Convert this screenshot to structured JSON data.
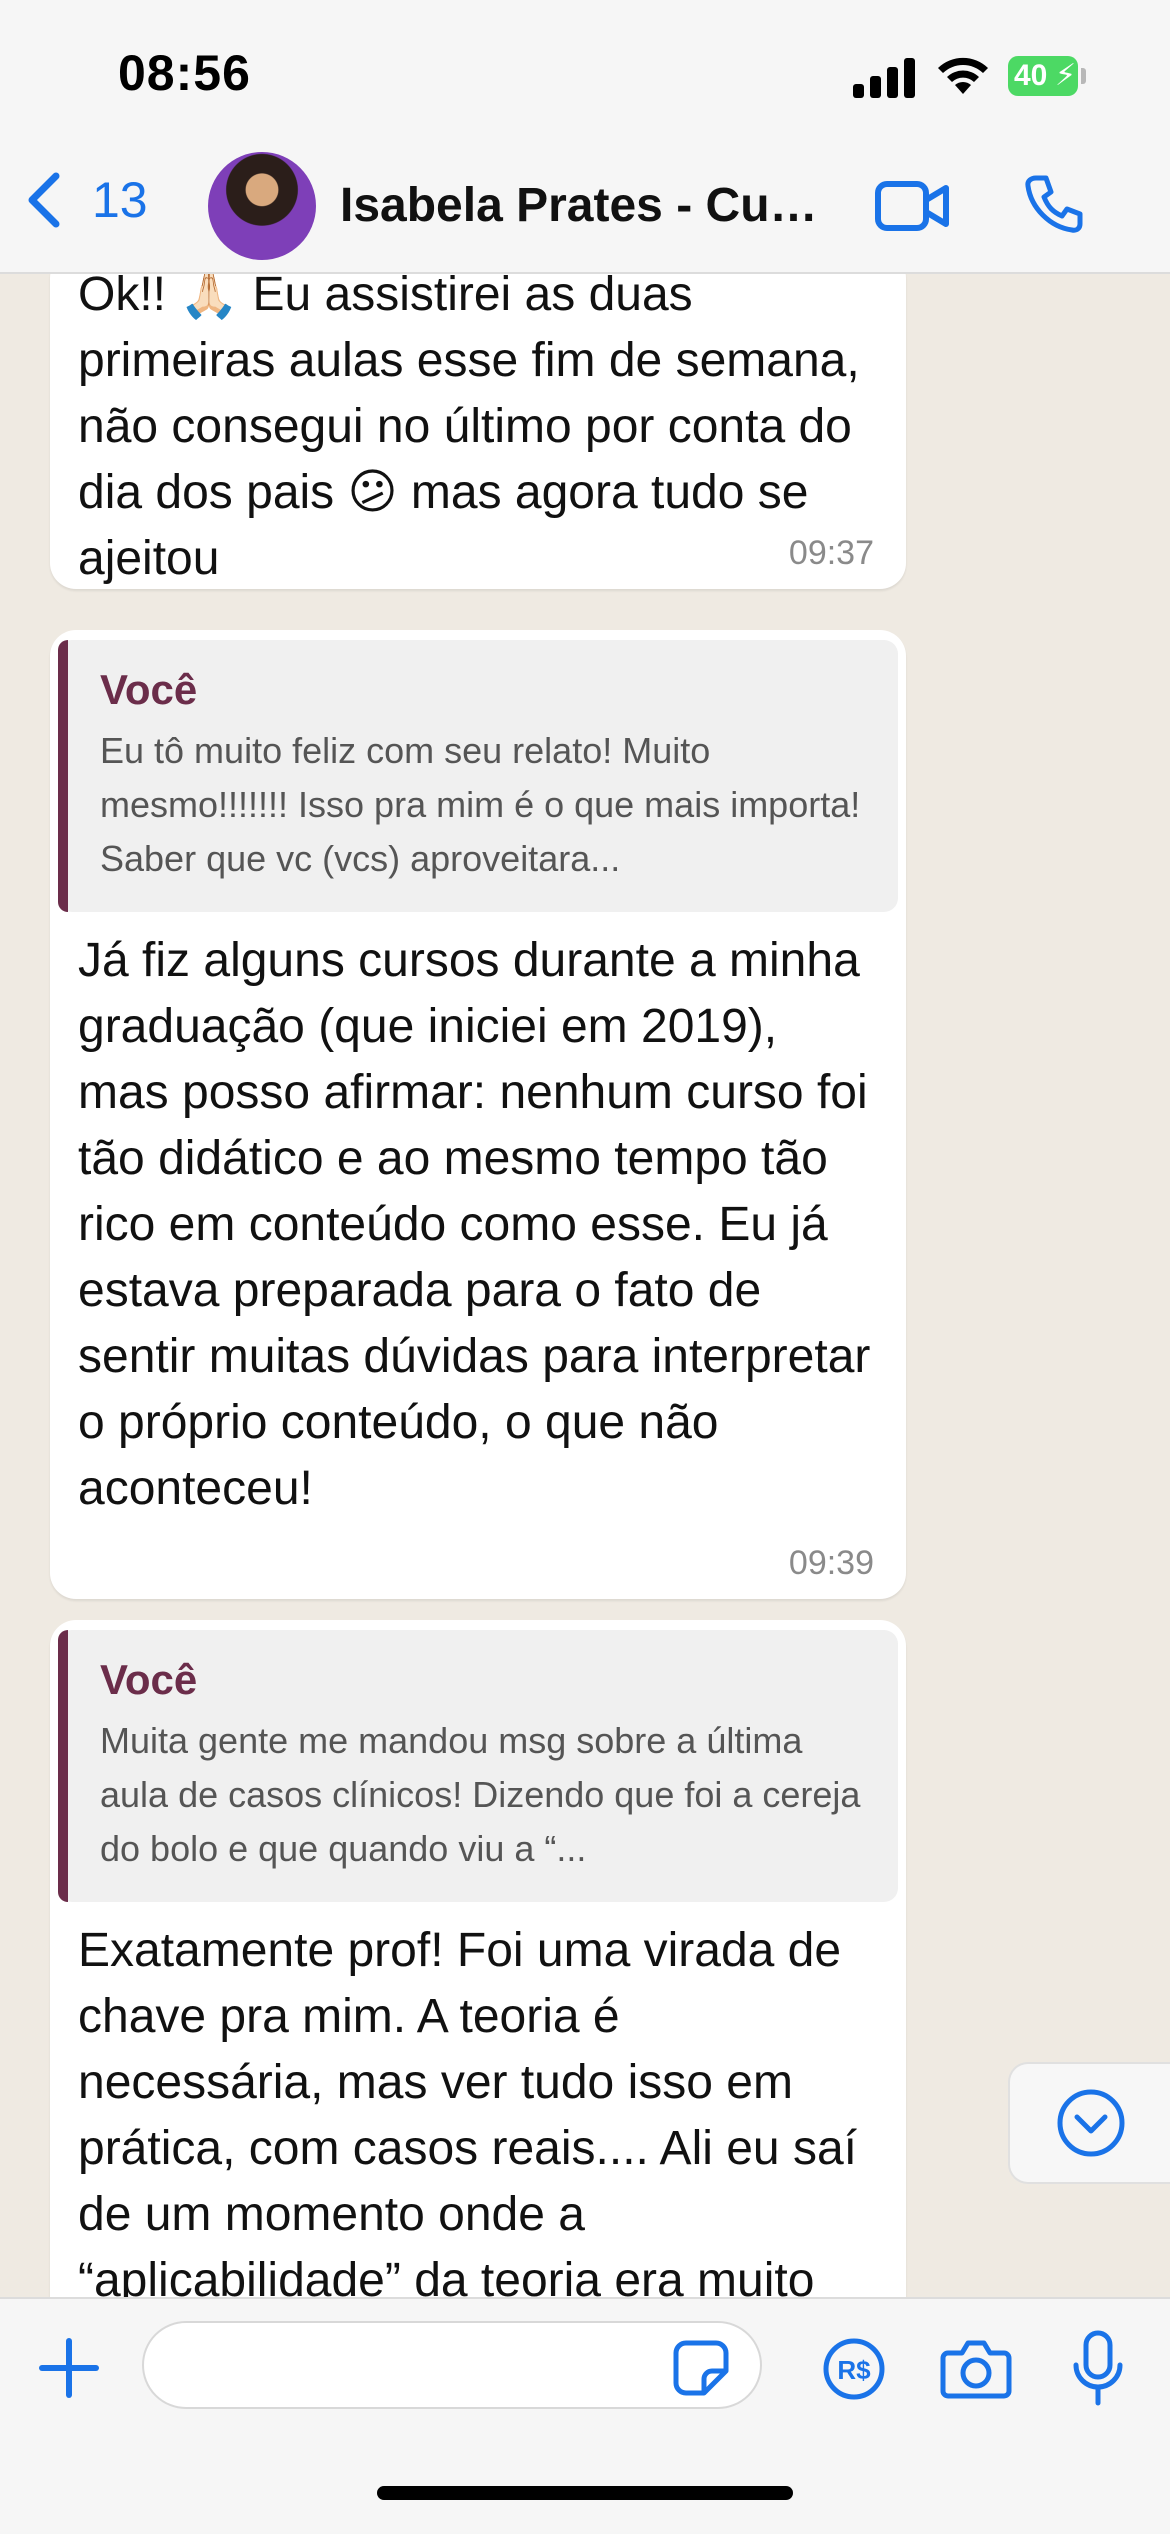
{
  "status_bar": {
    "time": "08:56",
    "battery": "40"
  },
  "header": {
    "back_count": "13",
    "contact_name": "Isabela Prates - Curso..."
  },
  "messages": [
    {
      "text": "Ok!! 🙏🏻 Eu assistirei as duas primeiras aulas esse fim de semana, não consegui no último por conta do dia dos pais 😕 mas agora tudo se ajeitou",
      "time": "09:37"
    },
    {
      "quote_author": "Você",
      "quote_text": "Eu tô muito feliz com seu relato! Muito mesmo!!!!!!! Isso pra mim é o que mais importa! Saber que vc (vcs) aproveitara...",
      "text": "Já fiz alguns cursos durante a minha graduação (que iniciei em 2019), mas posso afirmar: nenhum curso foi tão didático e ao mesmo tempo tão rico em conteúdo como esse. Eu já estava preparada para o fato de sentir muitas dúvidas para interpretar o próprio conteúdo, o que não aconteceu!",
      "time": "09:39"
    },
    {
      "quote_author": "Você",
      "quote_text": "Muita gente me mandou msg sobre a última aula de casos clínicos! Dizendo que foi a cereja do bolo e que quando viu a “...",
      "text": "Exatamente prof! Foi uma virada de chave pra mim. A teoria é necessária, mas ver tudo isso em prática, com casos reais.... Ali eu saí de um momento onde a “aplicabilidade” da teoria era muito"
    }
  ],
  "icons": {
    "back": "chevron-left-icon",
    "video": "video-camera-icon",
    "call": "phone-icon",
    "scroll": "chevron-down-circle-icon",
    "plus": "plus-icon",
    "sticker": "sticker-icon",
    "pix": "currency-brl-icon",
    "camera": "camera-icon",
    "mic": "microphone-icon"
  },
  "colors": {
    "accent": "#1a73e8",
    "quote_bar": "#6b2d4a",
    "chat_bg": "#efeae2"
  }
}
